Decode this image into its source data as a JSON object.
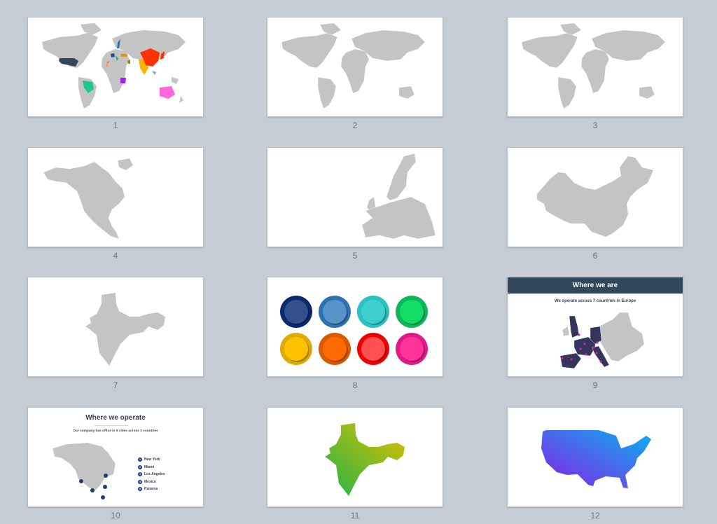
{
  "slides": [
    {
      "number": "1",
      "title": "World map with highlighted countries"
    },
    {
      "number": "2",
      "title": "World map gray"
    },
    {
      "number": "3",
      "title": "World map gray variant"
    },
    {
      "number": "4",
      "title": "North America map"
    },
    {
      "number": "5",
      "title": "Europe map"
    },
    {
      "number": "6",
      "title": "China map"
    },
    {
      "number": "7",
      "title": "India map"
    },
    {
      "number": "8",
      "title": "Color markers"
    },
    {
      "number": "9",
      "title": "Where we are"
    },
    {
      "number": "10",
      "title": "Where we operate"
    },
    {
      "number": "11",
      "title": "India gradient map"
    },
    {
      "number": "12",
      "title": "USA gradient map"
    }
  ],
  "slide9": {
    "header": "Where we are",
    "subtitle": "We operate across 7 countries in Europe"
  },
  "slide10": {
    "title": "Where we operate",
    "subtitle": "Our company has office in 5 cities across 3 countries",
    "cities": [
      {
        "n": "1",
        "name": "New York"
      },
      {
        "n": "2",
        "name": "Miami"
      },
      {
        "n": "3",
        "name": "Los Angeles"
      },
      {
        "n": "4",
        "name": "Mexico"
      },
      {
        "n": "5",
        "name": "Panama"
      }
    ]
  },
  "colors": {
    "map_gray": "#c4c4c4",
    "navy": "#33475b",
    "marker_pink": "#e619b8",
    "markers": [
      {
        "outer": "#0b2a6e",
        "inner": "#34508c"
      },
      {
        "outer": "#2f72b3",
        "inner": "#5a93c8"
      },
      {
        "outer": "#2ebfbf",
        "inner": "#3ecfcf"
      },
      {
        "outer": "#0fb55a",
        "inner": "#12dc66"
      },
      {
        "outer": "#e0ab00",
        "inner": "#ffc000"
      },
      {
        "outer": "#d95a00",
        "inner": "#ff6a00"
      },
      {
        "outer": "#f00000",
        "inner": "#ff5050"
      },
      {
        "outer": "#e01a86",
        "inner": "#ff3399"
      }
    ]
  }
}
